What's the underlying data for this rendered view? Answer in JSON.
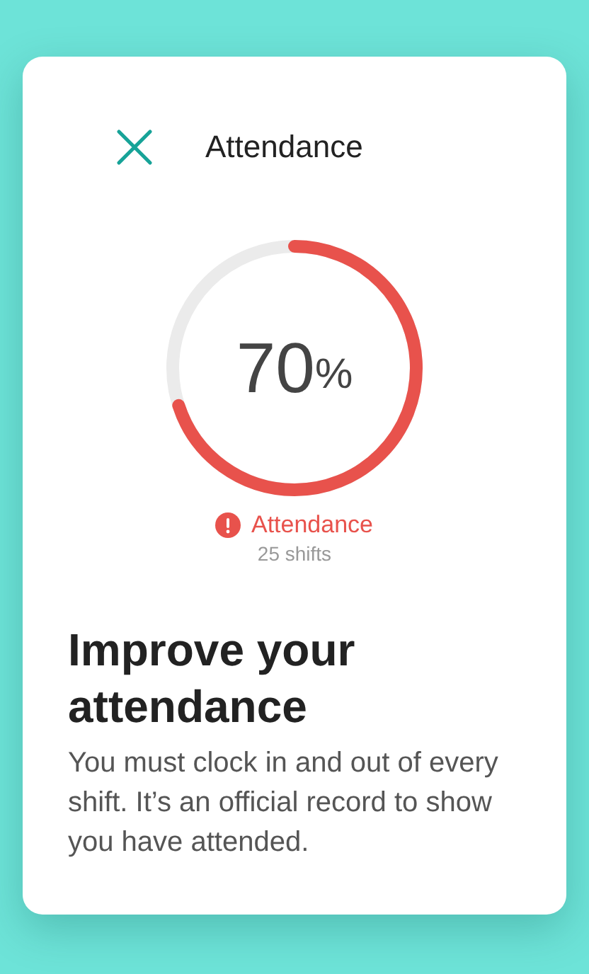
{
  "title": "Attendance",
  "meter": {
    "level": 0.7,
    "value": "70",
    "unit": "%",
    "status": "Attendance",
    "detail": "25 shifts"
  },
  "heading": "Improve your attendance",
  "body": "You must clock in and out of every shift. It’s an official record to show you have attended."
}
